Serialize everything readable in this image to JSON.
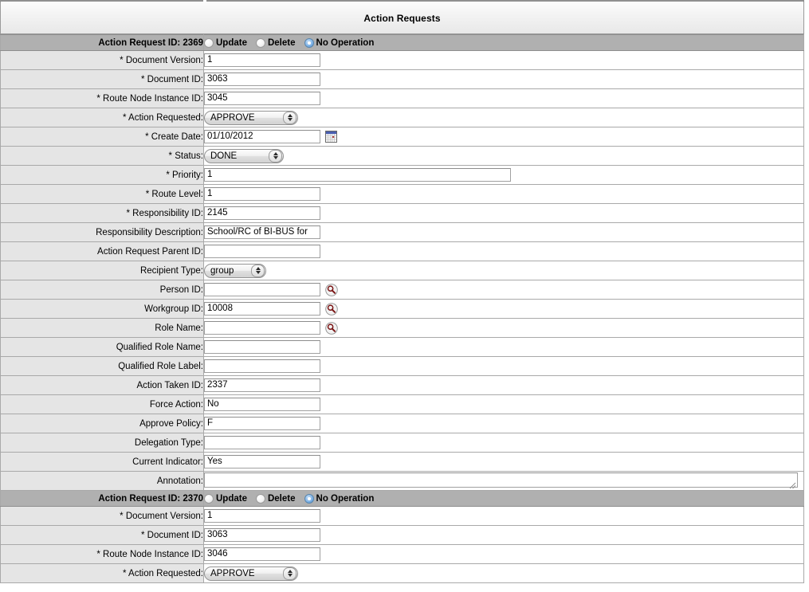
{
  "page": {
    "title": "Action Requests",
    "colors": {
      "section_header_bg": "#b0b0b0",
      "label_bg": "#e5e5e5",
      "border": "#a9a9a9",
      "radio_selected": "#7fb4e8",
      "calendar_header": "#4a5fb0",
      "calendar_today": "#b03030",
      "magnifier": "#7a1414"
    }
  },
  "operations": {
    "update_label": "Update",
    "delete_label": "Delete",
    "no_operation_label": "No Operation",
    "selected": "No Operation"
  },
  "sections": [
    {
      "header": "Action Request ID: 2369",
      "fields": [
        {
          "label": "* Document Version:",
          "type": "text",
          "value": "1"
        },
        {
          "label": "* Document ID:",
          "type": "text",
          "value": "3063"
        },
        {
          "label": "* Route Node Instance ID:",
          "type": "text",
          "value": "3045"
        },
        {
          "label": "* Action Requested:",
          "type": "select",
          "value": "APPROVE",
          "width": "w-approve"
        },
        {
          "label": "* Create Date:",
          "type": "date",
          "value": "01/10/2012"
        },
        {
          "label": "* Status:",
          "type": "select",
          "value": "DONE",
          "width": "w-done"
        },
        {
          "label": "* Priority:",
          "type": "text-wide",
          "value": "1"
        },
        {
          "label": "* Route Level:",
          "type": "text",
          "value": "1"
        },
        {
          "label": "* Responsibility ID:",
          "type": "text",
          "value": "2145"
        },
        {
          "label": "Responsibility Description:",
          "type": "text",
          "value": "School/RC of BI-BUS for"
        },
        {
          "label": "Action Request Parent ID:",
          "type": "text",
          "value": ""
        },
        {
          "label": "Recipient Type:",
          "type": "select",
          "value": "group",
          "width": "w-group"
        },
        {
          "label": "Person ID:",
          "type": "text-lookup",
          "value": ""
        },
        {
          "label": "Workgroup ID:",
          "type": "text-lookup",
          "value": "10008"
        },
        {
          "label": "Role Name:",
          "type": "text-lookup",
          "value": ""
        },
        {
          "label": "Qualified Role Name:",
          "type": "text",
          "value": ""
        },
        {
          "label": "Qualified Role Label:",
          "type": "text",
          "value": ""
        },
        {
          "label": "Action Taken ID:",
          "type": "text",
          "value": "2337"
        },
        {
          "label": "Force Action:",
          "type": "text",
          "value": "No"
        },
        {
          "label": "Approve Policy:",
          "type": "text",
          "value": "F"
        },
        {
          "label": "Delegation Type:",
          "type": "text",
          "value": ""
        },
        {
          "label": "Current Indicator:",
          "type": "text",
          "value": "Yes"
        },
        {
          "label": "Annotation:",
          "type": "textarea",
          "value": ""
        }
      ]
    },
    {
      "header": "Action Request ID: 2370",
      "fields": [
        {
          "label": "* Document Version:",
          "type": "text",
          "value": "1"
        },
        {
          "label": "* Document ID:",
          "type": "text",
          "value": "3063"
        },
        {
          "label": "* Route Node Instance ID:",
          "type": "text",
          "value": "3046"
        },
        {
          "label": "* Action Requested:",
          "type": "select",
          "value": "APPROVE",
          "width": "w-approve"
        }
      ]
    }
  ]
}
